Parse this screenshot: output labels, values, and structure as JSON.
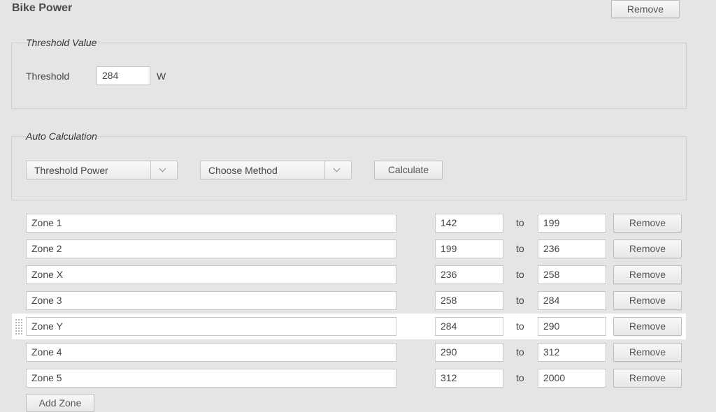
{
  "page": {
    "title": "Bike Power",
    "remove_label": "Remove"
  },
  "threshold_section": {
    "legend": "Threshold Value",
    "label": "Threshold",
    "value": "284",
    "unit": "W"
  },
  "auto_calc": {
    "legend": "Auto Calculation",
    "basis_select": "Threshold Power",
    "method_select": "Choose Method",
    "calculate_label": "Calculate"
  },
  "zones": {
    "to_label": "to",
    "remove_label": "Remove",
    "add_label": "Add Zone",
    "rows": [
      {
        "name": "Zone 1",
        "from": "142",
        "to": "199"
      },
      {
        "name": "Zone 2",
        "from": "199",
        "to": "236"
      },
      {
        "name": "Zone X",
        "from": "236",
        "to": "258"
      },
      {
        "name": "Zone 3",
        "from": "258",
        "to": "284"
      },
      {
        "name": "Zone Y",
        "from": "284",
        "to": "290"
      },
      {
        "name": "Zone 4",
        "from": "290",
        "to": "312"
      },
      {
        "name": "Zone 5",
        "from": "312",
        "to": "2000"
      }
    ]
  }
}
